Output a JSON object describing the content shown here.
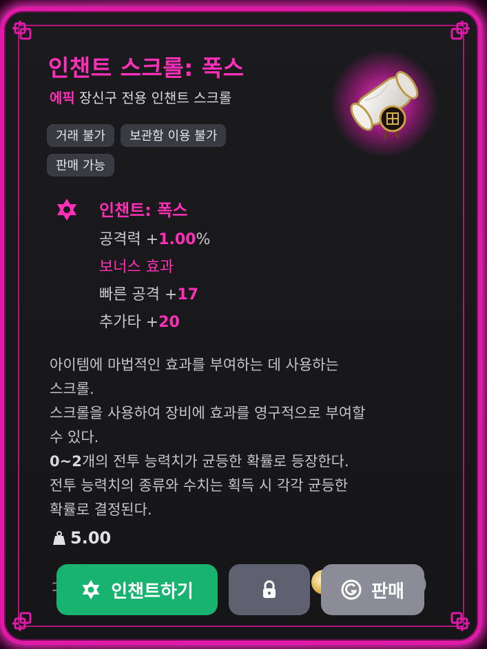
{
  "item": {
    "title": "인챈트 스크롤: 폭스",
    "grade": "에픽",
    "subtitle_rest": "장신구 전용 인챈트 스크롤",
    "tags": [
      "거래 불가",
      "보관함 이용 불가",
      "판매 가능"
    ]
  },
  "enchant": {
    "name": "인챈트: 폭스",
    "attack_label": "공격력 +",
    "attack_value": "1.00",
    "attack_unit": "%",
    "bonus_label": "보너스 효과",
    "fast_label": "빠른 공격 +",
    "fast_value": "17",
    "extra_label": "추가타 +",
    "extra_value": "20"
  },
  "description": {
    "line1": "아이템에 마법적인 효과를 부여하는 데 사용하는",
    "line2": "스크롤.",
    "line3": "스크롤을 사용하여 장비에 효과를 영구적으로 부여할",
    "line4": "수 있다.",
    "count_range": "0~2",
    "line5_rest": "개의 전투 능력치가 균등한 확률로 등장한다.",
    "line6": "전투 능력치의 종류와 수치는 획득 시 각각 균등한",
    "line7": "확률로 결정된다."
  },
  "weight": "5.00",
  "buttons": {
    "enchant": "인챈트하기",
    "sell": "판매"
  },
  "colors": {
    "accent": "#ff2fb8",
    "frame": "#e01aa8",
    "enchant_button": "#18b271",
    "lock_button": "#5f6170",
    "sell_button": "#8b8c97"
  },
  "icons": [
    "hexagram-star-icon",
    "weight-icon",
    "lock-icon",
    "sell-coin-icon",
    "scroll-item-icon",
    "knot-corner-icon"
  ]
}
